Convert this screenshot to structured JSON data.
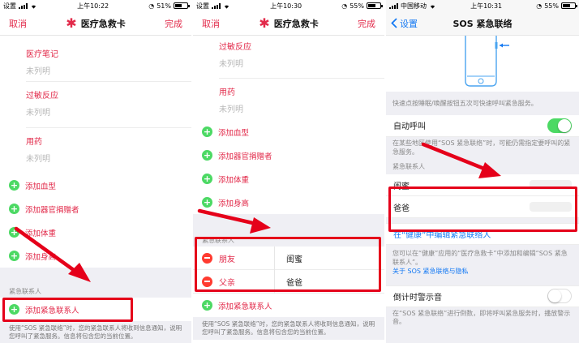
{
  "colors": {
    "accent_red": "#e22a4a",
    "ios_blue": "#1479f3",
    "ios_green": "#4cd964",
    "annotation_red": "#e5001a"
  },
  "screens": [
    {
      "status": {
        "carrier": "设置",
        "time": "上午10:22",
        "battery": "51%"
      },
      "nav": {
        "left": "取消",
        "title": "医疗急救卡",
        "right": "完成"
      },
      "fields": [
        {
          "label": "医疗笔记",
          "value": "未列明"
        },
        {
          "label": "过敏反应",
          "value": "未列明"
        },
        {
          "label": "用药",
          "value": "未列明"
        }
      ],
      "add_items": [
        "添加血型",
        "添加器官捐赠者",
        "添加体重",
        "添加身高"
      ],
      "section_header": "紧急联系人",
      "add_contact": "添加紧急联系人",
      "footer": "使用“SOS 紧急联络”时，您的紧急联系人将收到信息通知，说明您呼叫了紧急服务。信息将包含您的当前位置。"
    },
    {
      "status": {
        "carrier": "设置",
        "time": "上午10:30",
        "battery": "55%"
      },
      "nav": {
        "left": "取消",
        "title": "医疗急救卡",
        "right": "完成"
      },
      "fields": [
        {
          "label": "过敏反应",
          "value": "未列明"
        },
        {
          "label": "用药",
          "value": "未列明"
        }
      ],
      "add_items": [
        "添加血型",
        "添加器官捐赠者",
        "添加体重",
        "添加身高"
      ],
      "section_header": "紧急联系人",
      "contacts": [
        {
          "relation": "朋友",
          "name": "闺蜜"
        },
        {
          "relation": "父亲",
          "name": "爸爸"
        }
      ],
      "add_contact": "添加紧急联系人",
      "footer": "使用“SOS 紧急联络”时，您的紧急联系人将收到信息通知，说明您呼叫了紧急服务。信息将包含您的当前位置。"
    },
    {
      "status": {
        "carrier": "中国移动",
        "time": "上午10:31",
        "battery": "55%"
      },
      "nav": {
        "back": "设置",
        "title": "SOS 紧急联络"
      },
      "hint_press": "快速点按睡眠/唤醒按钮五次可快速呼叫紧急服务。",
      "auto_call": {
        "label": "自动呼叫",
        "on": true
      },
      "auto_call_note": "在某些地区使用“SOS 紧急联络”时，可能仍需指定要呼叫的紧急服务。",
      "section_header": "紧急联系人",
      "contacts": [
        "闺蜜",
        "爸爸"
      ],
      "edit_link": "在“健康”中编辑紧急联络人",
      "edit_note": "您可以在“健康”应用的“医疗急救卡”中添加和编辑“SOS 紧急联系人”。",
      "privacy_link": "关于 SOS 紧急联络与隐私",
      "countdown": {
        "label": "倒计时警示音",
        "on": false
      },
      "countdown_note": "在“SOS 紧急联络”进行倒数，即将呼叫紧急服务时，播放警示音。"
    }
  ]
}
